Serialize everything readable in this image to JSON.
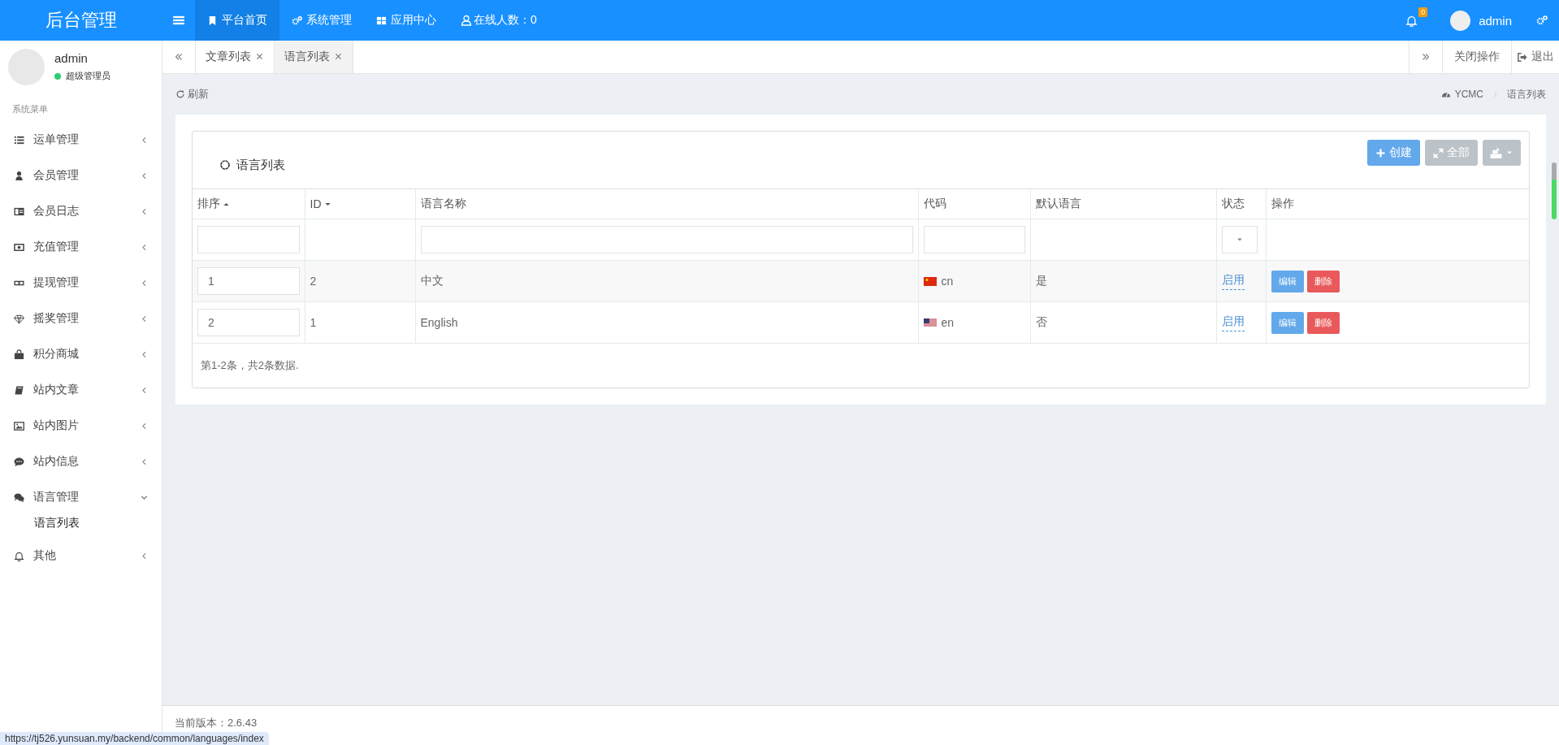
{
  "header": {
    "brand": "后台管理",
    "nav": [
      {
        "kind": "bookmark",
        "label": "平台首页",
        "selected": true
      },
      {
        "kind": "cogs",
        "label": "系统管理",
        "selected": false
      },
      {
        "kind": "grid",
        "label": "应用中心",
        "selected": false
      }
    ],
    "online": "在线人数：0",
    "notice_count": "0",
    "user": "admin"
  },
  "sidebar": {
    "user": "admin",
    "role": "超级管理员",
    "status_dot": {
      "color": "#2ecc71"
    },
    "menu_title": "系统菜单",
    "items": [
      {
        "kind": "list",
        "label": "运单管理",
        "expanded": false
      },
      {
        "kind": "user",
        "label": "会员管理",
        "expanded": false
      },
      {
        "kind": "idcard",
        "label": "会员日志",
        "expanded": false
      },
      {
        "kind": "money",
        "label": "充值管理",
        "expanded": false
      },
      {
        "kind": "ticket",
        "label": "提现管理",
        "expanded": false
      },
      {
        "kind": "diamond",
        "label": "摇奖管理",
        "expanded": false
      },
      {
        "kind": "bag",
        "label": "积分商城",
        "expanded": false
      },
      {
        "kind": "book",
        "label": "站内文章",
        "expanded": false
      },
      {
        "kind": "image",
        "label": "站内图片",
        "expanded": false
      },
      {
        "kind": "comment",
        "label": "站内信息",
        "expanded": false
      },
      {
        "kind": "comments",
        "label": "语言管理",
        "expanded": true,
        "children": [
          {
            "label": "语言列表"
          }
        ]
      },
      {
        "kind": "bell",
        "label": "其他",
        "expanded": false
      }
    ]
  },
  "tabs": [
    {
      "label": "文章列表",
      "selected": false
    },
    {
      "label": "语言列表",
      "selected": true
    }
  ],
  "tab_actions": {
    "close": "关闭操作",
    "logout": "退出"
  },
  "toolbar": {
    "refresh": "刷新",
    "breadcrumb": [
      "YCMC",
      "语言列表"
    ]
  },
  "box": {
    "title": "语言列表",
    "buttons": [
      {
        "kind": "create",
        "label": "创建"
      },
      {
        "kind": "all",
        "label": "全部"
      },
      {
        "kind": "export"
      }
    ],
    "table": {
      "columns": [
        {
          "label": "排序",
          "sort": {
            "kind": "asc"
          }
        },
        {
          "label": "ID",
          "sort": {
            "kind": "desc"
          }
        },
        {
          "label": "语言名称"
        },
        {
          "label": "代码"
        },
        {
          "label": "默认语言"
        },
        {
          "label": "状态"
        },
        {
          "label": "操作"
        }
      ],
      "filters": [
        {
          "kind": "text"
        },
        {
          "kind": "none"
        },
        {
          "kind": "text"
        },
        {
          "kind": "text"
        },
        {
          "kind": "none"
        },
        {
          "kind": "select"
        },
        {
          "kind": "none"
        }
      ],
      "rows": [
        {
          "order": "1",
          "id": "2",
          "name": "中文",
          "flag": {
            "kind": "cn"
          },
          "code": "cn",
          "default": "是",
          "status": "启用",
          "actions": [
            "编辑",
            "删除"
          ]
        },
        {
          "order": "2",
          "id": "1",
          "name": "English",
          "flag": {
            "kind": "us"
          },
          "code": "en",
          "default": "否",
          "status": "启用",
          "actions": [
            "编辑",
            "删除"
          ]
        }
      ]
    },
    "summary": "第1-2条，共2条数据."
  },
  "footer": {
    "version": "当前版本：2.6.43"
  },
  "status_url": "https://tj526.yunsuan.my/backend/common/languages/index"
}
